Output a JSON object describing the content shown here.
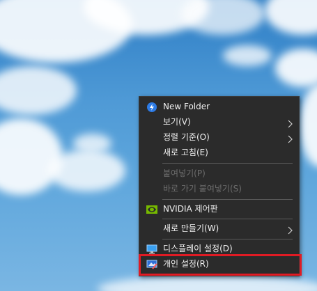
{
  "context_menu": {
    "items": [
      {
        "label": "New Folder",
        "icon": "new-folder-icon"
      },
      {
        "label": "보기(V)",
        "has_submenu": true
      },
      {
        "label": "정렬 기준(O)",
        "has_submenu": true
      },
      {
        "label": "새로 고침(E)"
      },
      {
        "label": "붙여넣기(P)",
        "disabled": true
      },
      {
        "label": "바로 가기 붙여넣기(S)",
        "disabled": true
      },
      {
        "label": "NVIDIA 제어판",
        "icon": "nvidia-icon"
      },
      {
        "label": "새로 만들기(W)",
        "has_submenu": true
      },
      {
        "label": "디스플레이 설정(D)",
        "icon": "display-icon"
      },
      {
        "label": "개인 설정(R)",
        "icon": "personalize-icon",
        "highlighted": true
      }
    ]
  },
  "colors": {
    "menu_background": "#2b2b2b",
    "menu_text": "#f0f0f0",
    "disabled_text": "#6d6d6d",
    "highlight_border": "#e01b24",
    "nvidia_green": "#76b900"
  }
}
